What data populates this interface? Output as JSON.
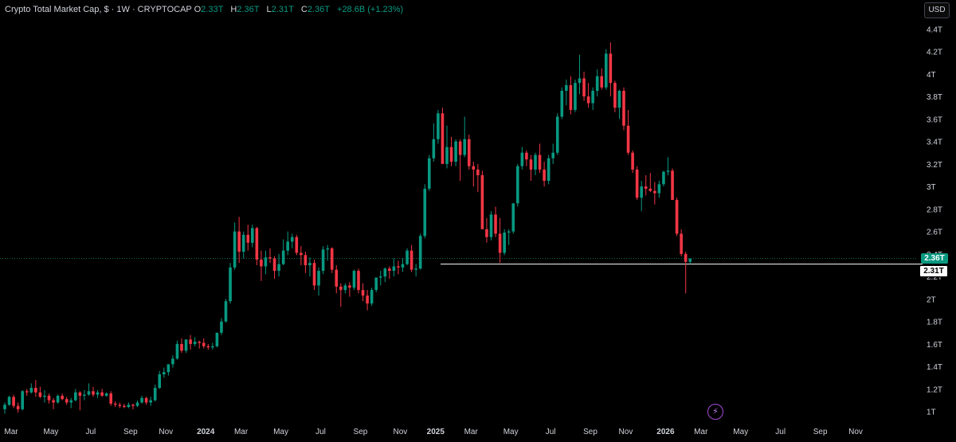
{
  "header": {
    "title": "Crypto Total Market Cap, $ · 1W · CRYPTOCAP",
    "o_label": "O",
    "o_value": "2.33T",
    "h_label": "H",
    "h_value": "2.36T",
    "l_label": "L",
    "l_value": "2.31T",
    "c_label": "C",
    "c_value": "2.36T",
    "change": "+28.6B (+1.23%)"
  },
  "currency_button": "USD",
  "price_tags": {
    "current": "2.36T",
    "horizontal_line": "2.31T"
  },
  "icons": {
    "alert": "lightning-bolt-icon"
  },
  "colors": {
    "up": "#089981",
    "down": "#f23645",
    "background": "#000000",
    "axis_text": "#d1d4dc",
    "line": "#ffffff"
  },
  "chart_data": {
    "type": "candlestick",
    "interval": "1W",
    "y_unit": "T",
    "ylim": [
      0.92,
      4.48
    ],
    "grid": false,
    "y_ticks": [
      1,
      1.2,
      1.4,
      1.6,
      1.8,
      2,
      2.2,
      2.4,
      2.6,
      2.8,
      3,
      3.2,
      3.4,
      3.6,
      3.8,
      4,
      4.2,
      4.4
    ],
    "y_tick_labels": [
      "1T",
      "1.2T",
      "1.4T",
      "1.6T",
      "1.8T",
      "2T",
      "2.2T",
      "2.4T",
      "2.6T",
      "2.8T",
      "3T",
      "3.2T",
      "3.4T",
      "3.6T",
      "3.8T",
      "4T",
      "4.2T",
      "4.4T"
    ],
    "x_ticks": [
      {
        "label": "Mar",
        "week": 0
      },
      {
        "label": "May",
        "week": 9
      },
      {
        "label": "Jul",
        "week": 18
      },
      {
        "label": "Sep",
        "week": 27
      },
      {
        "label": "Nov",
        "week": 35
      },
      {
        "label": "2024",
        "week": 44
      },
      {
        "label": "Mar",
        "week": 52
      },
      {
        "label": "May",
        "week": 61
      },
      {
        "label": "Jul",
        "week": 70
      },
      {
        "label": "Sep",
        "week": 79
      },
      {
        "label": "Nov",
        "week": 88
      },
      {
        "label": "2025",
        "week": 96
      },
      {
        "label": "Mar",
        "week": 104
      },
      {
        "label": "May",
        "week": 113
      },
      {
        "label": "Jul",
        "week": 122
      },
      {
        "label": "Sep",
        "week": 131
      },
      {
        "label": "Nov",
        "week": 139
      },
      {
        "label": "2026",
        "week": 148
      },
      {
        "label": "Mar",
        "week": 156
      },
      {
        "label": "May",
        "week": 165
      },
      {
        "label": "Jul",
        "week": 174
      },
      {
        "label": "Sep",
        "week": 183
      },
      {
        "label": "Nov",
        "week": 191
      }
    ],
    "horizontal_line": 2.31,
    "current_price": 2.36,
    "candles": [
      [
        1.02,
        1.08,
        0.98,
        1.06
      ],
      [
        1.06,
        1.14,
        1.05,
        1.13
      ],
      [
        1.13,
        1.15,
        1.03,
        1.05
      ],
      [
        1.05,
        1.08,
        0.99,
        1.02
      ],
      [
        1.02,
        1.19,
        1.01,
        1.18
      ],
      [
        1.18,
        1.2,
        1.14,
        1.17
      ],
      [
        1.17,
        1.25,
        1.16,
        1.21
      ],
      [
        1.21,
        1.28,
        1.13,
        1.17
      ],
      [
        1.17,
        1.22,
        1.12,
        1.13
      ],
      [
        1.13,
        1.19,
        1.08,
        1.14
      ],
      [
        1.14,
        1.16,
        1.07,
        1.1
      ],
      [
        1.1,
        1.12,
        1.02,
        1.08
      ],
      [
        1.08,
        1.15,
        1.07,
        1.14
      ],
      [
        1.14,
        1.16,
        1.1,
        1.11
      ],
      [
        1.11,
        1.13,
        1.06,
        1.08
      ],
      [
        1.08,
        1.12,
        1.03,
        1.1
      ],
      [
        1.1,
        1.2,
        1.09,
        1.17
      ],
      [
        1.17,
        1.18,
        1.01,
        1.14
      ],
      [
        1.14,
        1.19,
        1.1,
        1.15
      ],
      [
        1.15,
        1.25,
        1.14,
        1.18
      ],
      [
        1.18,
        1.22,
        1.13,
        1.15
      ],
      [
        1.15,
        1.19,
        1.12,
        1.17
      ],
      [
        1.17,
        1.2,
        1.13,
        1.14
      ],
      [
        1.14,
        1.17,
        1.13,
        1.16
      ],
      [
        1.16,
        1.18,
        1.05,
        1.07
      ],
      [
        1.07,
        1.09,
        1.04,
        1.06
      ],
      [
        1.06,
        1.08,
        1.03,
        1.05
      ],
      [
        1.05,
        1.07,
        1.03,
        1.04
      ],
      [
        1.04,
        1.08,
        1.03,
        1.06
      ],
      [
        1.06,
        1.07,
        1.02,
        1.05
      ],
      [
        1.05,
        1.1,
        1.04,
        1.08
      ],
      [
        1.08,
        1.14,
        1.07,
        1.12
      ],
      [
        1.12,
        1.13,
        1.06,
        1.08
      ],
      [
        1.08,
        1.13,
        1.05,
        1.1
      ],
      [
        1.1,
        1.24,
        1.09,
        1.21
      ],
      [
        1.21,
        1.36,
        1.2,
        1.33
      ],
      [
        1.33,
        1.39,
        1.3,
        1.35
      ],
      [
        1.35,
        1.42,
        1.32,
        1.42
      ],
      [
        1.42,
        1.5,
        1.39,
        1.47
      ],
      [
        1.47,
        1.63,
        1.46,
        1.6
      ],
      [
        1.6,
        1.65,
        1.52,
        1.54
      ],
      [
        1.54,
        1.64,
        1.52,
        1.64
      ],
      [
        1.64,
        1.68,
        1.55,
        1.6
      ],
      [
        1.6,
        1.66,
        1.58,
        1.62
      ],
      [
        1.62,
        1.63,
        1.56,
        1.61
      ],
      [
        1.61,
        1.65,
        1.56,
        1.58
      ],
      [
        1.58,
        1.6,
        1.55,
        1.57
      ],
      [
        1.57,
        1.61,
        1.55,
        1.58
      ],
      [
        1.58,
        1.7,
        1.57,
        1.7
      ],
      [
        1.7,
        1.83,
        1.68,
        1.8
      ],
      [
        1.8,
        2.0,
        1.79,
        1.98
      ],
      [
        1.98,
        2.32,
        1.96,
        2.28
      ],
      [
        2.28,
        2.68,
        2.26,
        2.6
      ],
      [
        2.6,
        2.73,
        2.32,
        2.42
      ],
      [
        2.42,
        2.6,
        2.36,
        2.57
      ],
      [
        2.57,
        2.66,
        2.43,
        2.5
      ],
      [
        2.5,
        2.66,
        2.46,
        2.63
      ],
      [
        2.63,
        2.64,
        2.3,
        2.35
      ],
      [
        2.35,
        2.43,
        2.16,
        2.29
      ],
      [
        2.29,
        2.43,
        2.22,
        2.37
      ],
      [
        2.37,
        2.45,
        2.32,
        2.36
      ],
      [
        2.36,
        2.38,
        2.18,
        2.25
      ],
      [
        2.25,
        2.4,
        2.2,
        2.31
      ],
      [
        2.31,
        2.53,
        2.3,
        2.43
      ],
      [
        2.43,
        2.6,
        2.39,
        2.51
      ],
      [
        2.51,
        2.58,
        2.45,
        2.55
      ],
      [
        2.55,
        2.57,
        2.39,
        2.41
      ],
      [
        2.41,
        2.47,
        2.3,
        2.39
      ],
      [
        2.39,
        2.42,
        2.23,
        2.3
      ],
      [
        2.3,
        2.37,
        2.2,
        2.32
      ],
      [
        2.32,
        2.35,
        2.08,
        2.12
      ],
      [
        2.12,
        2.28,
        2.03,
        2.25
      ],
      [
        2.25,
        2.47,
        2.22,
        2.44
      ],
      [
        2.44,
        2.48,
        2.34,
        2.45
      ],
      [
        2.45,
        2.46,
        2.23,
        2.26
      ],
      [
        2.26,
        2.3,
        2.05,
        2.11
      ],
      [
        2.11,
        2.14,
        1.93,
        2.08
      ],
      [
        2.08,
        2.14,
        2.05,
        2.12
      ],
      [
        2.12,
        2.15,
        2.02,
        2.1
      ],
      [
        2.1,
        2.26,
        2.08,
        2.25
      ],
      [
        2.25,
        2.27,
        2.05,
        2.08
      ],
      [
        2.08,
        2.14,
        1.98,
        2.03
      ],
      [
        2.03,
        2.08,
        1.9,
        1.96
      ],
      [
        1.96,
        2.1,
        1.94,
        2.08
      ],
      [
        2.08,
        2.19,
        2.06,
        2.19
      ],
      [
        2.19,
        2.25,
        2.12,
        2.2
      ],
      [
        2.2,
        2.28,
        2.15,
        2.27
      ],
      [
        2.27,
        2.29,
        2.18,
        2.25
      ],
      [
        2.25,
        2.36,
        2.2,
        2.29
      ],
      [
        2.29,
        2.34,
        2.22,
        2.28
      ],
      [
        2.28,
        2.36,
        2.24,
        2.31
      ],
      [
        2.31,
        2.45,
        2.3,
        2.43
      ],
      [
        2.43,
        2.48,
        2.24,
        2.26
      ],
      [
        2.26,
        2.31,
        2.2,
        2.27
      ],
      [
        2.27,
        2.58,
        2.26,
        2.56
      ],
      [
        2.56,
        3.02,
        2.54,
        2.98
      ],
      [
        2.98,
        3.28,
        2.96,
        3.25
      ],
      [
        3.25,
        3.56,
        3.22,
        3.42
      ],
      [
        3.42,
        3.68,
        3.38,
        3.65
      ],
      [
        3.65,
        3.7,
        3.26,
        3.2
      ],
      [
        3.2,
        3.54,
        3.16,
        3.35
      ],
      [
        3.35,
        3.44,
        3.18,
        3.22
      ],
      [
        3.22,
        3.42,
        3.18,
        3.4
      ],
      [
        3.4,
        3.42,
        3.05,
        3.28
      ],
      [
        3.28,
        3.62,
        3.26,
        3.42
      ],
      [
        3.42,
        3.46,
        3.15,
        3.18
      ],
      [
        3.18,
        3.22,
        3.0,
        3.15
      ],
      [
        3.15,
        3.2,
        2.95,
        3.1
      ],
      [
        3.1,
        3.14,
        2.64,
        2.62
      ],
      [
        2.62,
        2.72,
        2.5,
        2.55
      ],
      [
        2.55,
        2.78,
        2.52,
        2.75
      ],
      [
        2.75,
        2.82,
        2.55,
        2.58
      ],
      [
        2.58,
        2.72,
        2.32,
        2.41
      ],
      [
        2.41,
        2.62,
        2.39,
        2.59
      ],
      [
        2.59,
        2.62,
        2.48,
        2.6
      ],
      [
        2.6,
        2.85,
        2.58,
        2.85
      ],
      [
        2.85,
        3.2,
        2.82,
        3.18
      ],
      [
        3.18,
        3.35,
        3.15,
        3.3
      ],
      [
        3.3,
        3.32,
        3.18,
        3.24
      ],
      [
        3.24,
        3.28,
        3.05,
        3.15
      ],
      [
        3.15,
        3.3,
        3.1,
        3.28
      ],
      [
        3.28,
        3.38,
        3.12,
        3.15
      ],
      [
        3.15,
        3.22,
        3.0,
        3.05
      ],
      [
        3.05,
        3.28,
        3.02,
        3.25
      ],
      [
        3.25,
        3.38,
        3.2,
        3.3
      ],
      [
        3.3,
        3.65,
        3.28,
        3.62
      ],
      [
        3.62,
        3.88,
        3.6,
        3.85
      ],
      [
        3.85,
        3.95,
        3.72,
        3.9
      ],
      [
        3.9,
        3.98,
        3.64,
        3.68
      ],
      [
        3.68,
        3.95,
        3.66,
        3.92
      ],
      [
        3.92,
        4.17,
        3.82,
        3.96
      ],
      [
        3.96,
        4.02,
        3.76,
        3.8
      ],
      [
        3.8,
        3.92,
        3.7,
        3.74
      ],
      [
        3.74,
        3.88,
        3.68,
        3.85
      ],
      [
        3.85,
        4.04,
        3.8,
        3.98
      ],
      [
        3.98,
        4.05,
        3.86,
        3.88
      ],
      [
        3.88,
        4.22,
        3.86,
        4.18
      ],
      [
        4.18,
        4.28,
        3.8,
        3.92
      ],
      [
        3.92,
        3.94,
        3.66,
        3.7
      ],
      [
        3.7,
        3.86,
        3.6,
        3.85
      ],
      [
        3.85,
        3.88,
        3.5,
        3.54
      ],
      [
        3.54,
        3.68,
        3.28,
        3.3
      ],
      [
        3.3,
        3.32,
        3.12,
        3.15
      ],
      [
        3.15,
        3.18,
        2.88,
        2.9
      ],
      [
        2.9,
        3.05,
        2.78,
        3.0
      ],
      [
        3.0,
        3.1,
        2.92,
        2.98
      ],
      [
        2.98,
        3.12,
        2.95,
        2.96
      ],
      [
        2.96,
        3.04,
        2.84,
        2.94
      ],
      [
        2.94,
        3.05,
        2.9,
        3.02
      ],
      [
        3.02,
        3.14,
        3.0,
        3.13
      ],
      [
        3.13,
        3.26,
        3.1,
        3.14
      ],
      [
        3.14,
        3.16,
        2.88,
        2.88
      ],
      [
        2.88,
        2.9,
        2.56,
        2.58
      ],
      [
        2.58,
        2.62,
        2.38,
        2.4
      ],
      [
        2.4,
        2.42,
        2.05,
        2.33
      ],
      [
        2.33,
        2.36,
        2.31,
        2.36
      ]
    ]
  }
}
